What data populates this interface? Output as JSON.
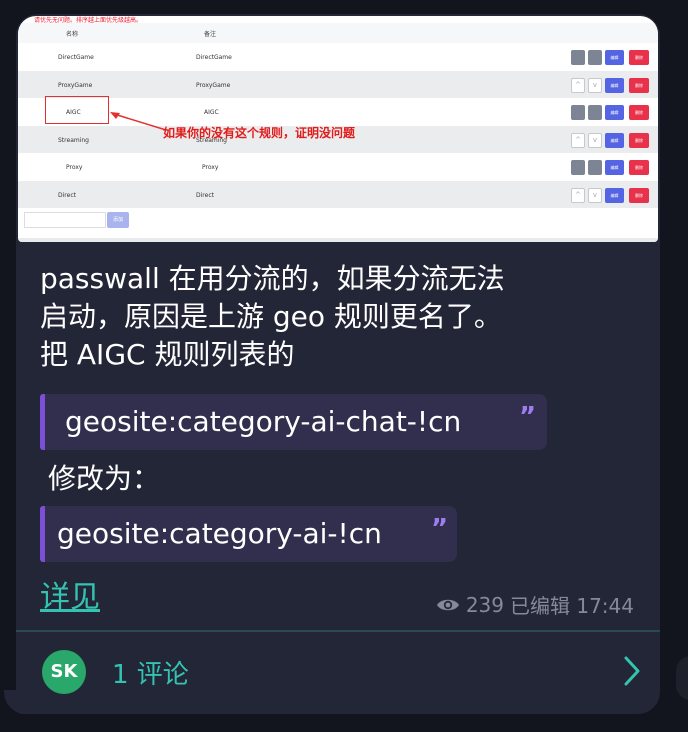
{
  "screenshot": {
    "top_note": "请优先无问题。排序越上面优先级越高。",
    "headers": {
      "name": "名称",
      "remark": "备注"
    },
    "rows": [
      {
        "name": "DirectGame",
        "remark": "DirectGame",
        "style": "gray-squares"
      },
      {
        "name": "ProxyGame",
        "remark": "ProxyGame",
        "style": "arrows"
      },
      {
        "name": "AIGC",
        "remark": "AIGC",
        "style": "gray-squares"
      },
      {
        "name": "Streaming",
        "remark": "Streaming",
        "style": "arrows"
      },
      {
        "name": "Proxy",
        "remark": "Proxy",
        "style": "gray-squares"
      },
      {
        "name": "Direct",
        "remark": "Direct",
        "style": "arrows"
      }
    ],
    "edit_label": "编辑",
    "delete_label": "删除",
    "add_label": "添加",
    "annotation": "如果你的没有这个规则，证明没问题"
  },
  "message": {
    "line1": "passwall 在用分流的，如果分流无法",
    "line2": "启动，原因是上游 geo 规则更名了。",
    "line3": "把 AIGC 规则列表的",
    "old_rule": "geosite:category-ai-chat-!cn",
    "change_to": "修改为：",
    "new_rule": "geosite:category-ai-!cn",
    "quote_mark": "”",
    "link": "详见"
  },
  "meta": {
    "views": "239",
    "edited": "已编辑 17:44",
    "icon": "eye-icon"
  },
  "comments": {
    "avatar": "SK",
    "label": "1 评论",
    "icon": "chevron-right-icon"
  },
  "colors": {
    "accent": "#34c3b0",
    "quote_border": "#7b4fd6",
    "bubble": "#232636",
    "avatar": "#2aa86c"
  }
}
